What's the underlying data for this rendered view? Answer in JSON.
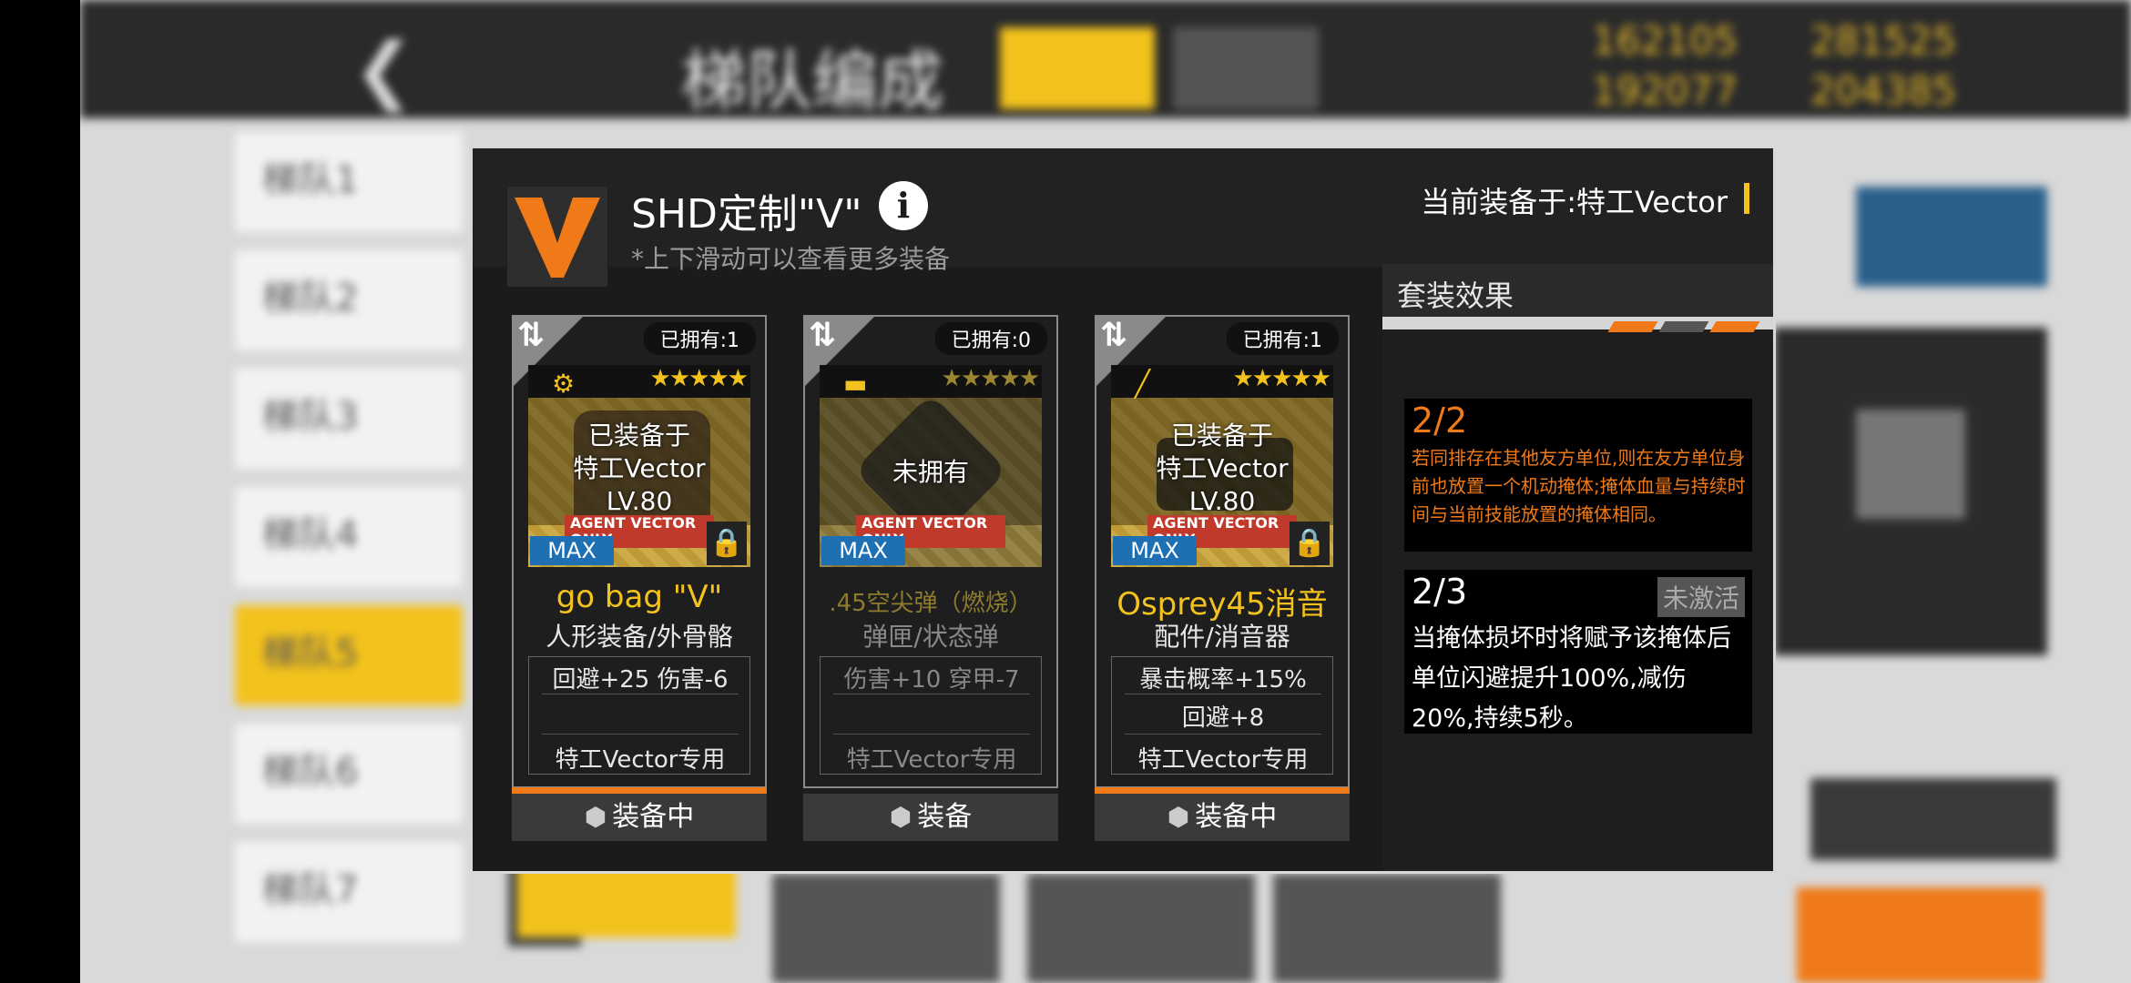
{
  "background": {
    "title": "梯队编成",
    "resources": [
      "162105",
      "281525",
      "192077",
      "204385"
    ],
    "echelon_tabs": [
      {
        "label": "梯队",
        "num": "1"
      },
      {
        "label": "梯队",
        "num": "2"
      },
      {
        "label": "梯队",
        "num": "3"
      },
      {
        "label": "梯队",
        "num": "4"
      },
      {
        "label": "梯队",
        "num": "5"
      },
      {
        "label": "梯队",
        "num": "6"
      },
      {
        "label": "梯队",
        "num": "7"
      }
    ]
  },
  "dialog": {
    "title": "SHD定制\"V\"",
    "hint": "*上下滑动可以查看更多装备",
    "equipped_on": "当前装备于:特工Vector",
    "info_symbol": "i",
    "logo_letter": "V"
  },
  "cards": [
    {
      "owned": "已拥有:1",
      "stars": "★★★★★",
      "status": "已装备于\n特工Vector\nLV.80",
      "agent_tag": "AGENT VECTOR ONLY",
      "max": "MAX",
      "name": "go bag \"V\"",
      "type": "人形装备/外骨骼",
      "stat1": "回避+25 伤害-6",
      "stat2": "",
      "exclusive": "特工Vector专用",
      "button": "装备中",
      "type_icon": "exoskeleton-icon"
    },
    {
      "owned": "已拥有:0",
      "stars": "★★★★★",
      "status": "未拥有",
      "agent_tag": "AGENT VECTOR ONLY",
      "max": "MAX",
      "name": ".45空尖弹（燃烧）",
      "type": "弹匣/状态弹",
      "stat1": "伤害+10 穿甲-7",
      "stat2": "",
      "exclusive": "特工Vector专用",
      "button": "装备",
      "type_icon": "ammo-icon"
    },
    {
      "owned": "已拥有:1",
      "stars": "★★★★★",
      "status": "已装备于\n特工Vector\nLV.80",
      "agent_tag": "AGENT VECTOR ONLY",
      "max": "MAX",
      "name": "Osprey45消音",
      "type": "配件/消音器",
      "stat1": "暴击概率+15%",
      "stat2": "回避+8",
      "exclusive": "特工Vector专用",
      "button": "装备中",
      "type_icon": "suppressor-icon"
    }
  ],
  "set_effect": {
    "title": "套装效果",
    "effect1": {
      "count": "2/2",
      "desc": "若同排存在其他友方单位,则在友方单位身前也放置一个机动掩体;掩体血量与持续时间与当前技能放置的掩体相同。"
    },
    "effect2": {
      "count": "2/3",
      "status": "未激活",
      "desc": "当掩体损坏时将赋予该掩体后单位闪避提升100%,减伤20%,持续5秒。"
    }
  },
  "colors": {
    "accent_yellow": "#f3c21c",
    "accent_orange": "#f07a18",
    "max_blue": "#1f6fb3"
  }
}
